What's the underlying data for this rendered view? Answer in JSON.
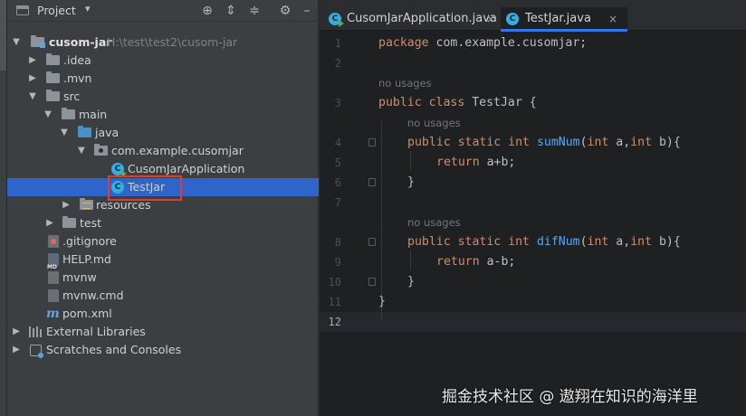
{
  "project_panel": {
    "title": "Project",
    "toolbar_icons": [
      "crosshair-icon",
      "expand-all-icon",
      "collapse-all-icon",
      "gear-icon",
      "hide-icon"
    ]
  },
  "tree": {
    "root": {
      "name": "cusom-jar",
      "path": "H:\\test\\test2\\cusom-jar"
    },
    "idea": ".idea",
    "mvn": ".mvn",
    "src": "src",
    "main": "main",
    "java": "java",
    "package": "com.example.cusomjar",
    "app_class": "CusomJarApplication",
    "test_jar": "TestJar",
    "resources": "resources",
    "test": "test",
    "gitignore": ".gitignore",
    "help": "HELP.md",
    "mvnw": "mvnw",
    "mvnw_cmd": "mvnw.cmd",
    "pom": "pom.xml",
    "external_libraries": "External Libraries",
    "scratches": "Scratches and Consoles"
  },
  "tabs": [
    {
      "label": "CusomJarApplication.java",
      "close": "×",
      "active": false
    },
    {
      "label": "TestJar.java",
      "close": "×",
      "active": true
    }
  ],
  "editor": {
    "line_numbers": [
      "1",
      "2",
      "3",
      "4",
      "5",
      "6",
      "7",
      "8",
      "9",
      "10",
      "11",
      "12"
    ],
    "current_line": "12",
    "hint": "no usages",
    "code": {
      "l1_kw": "package",
      "l1_rest": " com.example.cusomjar;",
      "l3_kw": "public class",
      "l3_rest": " TestJar {",
      "l4_kw": "public static int",
      "l4_fn": "sumNum",
      "l4_p1": "(",
      "l4_kw2": "int",
      "l4_p2": " a,",
      "l4_kw3": "int",
      "l4_p3": " b){",
      "l5_kw": "return",
      "l5_rest": " a+b;",
      "l6": "}",
      "l8_kw": "public static int",
      "l8_fn": "difNum",
      "l8_p1": "(",
      "l8_kw2": "int",
      "l8_p2": " a,",
      "l8_kw3": "int",
      "l8_p3": " b){",
      "l9_kw": "return",
      "l9_rest": " a-b;",
      "l10": "}",
      "l11": "}"
    }
  },
  "watermark": "掘金技术社区 @ 遨翔在知识的海洋里",
  "colors": {
    "selection": "#2f65ca",
    "keyword": "#cf8e6d",
    "function": "#56a8f5",
    "highlight_box": "#e53935"
  }
}
